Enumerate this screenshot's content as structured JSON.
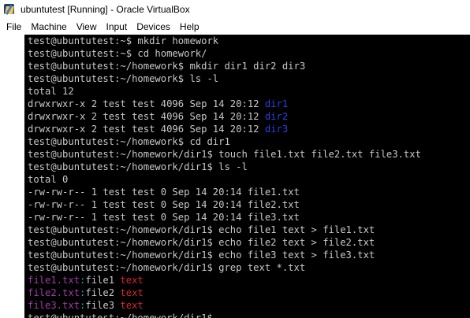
{
  "window": {
    "title": "ubuntutest [Running] - Oracle VirtualBox",
    "icon": "virtualbox-icon"
  },
  "menu": {
    "items": [
      "File",
      "Machine",
      "View",
      "Input",
      "Devices",
      "Help"
    ]
  },
  "colors": {
    "terminal_bg": "#000000",
    "terminal_fg": "#c8c8c8",
    "directory": "#2a3ee6",
    "grep_filename": "#a03ba8",
    "grep_separator": "#2aa7b8",
    "grep_match": "#d9262b"
  },
  "terminal": {
    "lines": [
      [
        {
          "t": "test@ubuntutest:~$ mkdir homework",
          "c": "default"
        }
      ],
      [
        {
          "t": "test@ubuntutest:~$ cd homework/",
          "c": "default"
        }
      ],
      [
        {
          "t": "test@ubuntutest:~/homework$ mkdir dir1 dir2 dir3",
          "c": "default"
        }
      ],
      [
        {
          "t": "test@ubuntutest:~/homework$ ls -l",
          "c": "default"
        }
      ],
      [
        {
          "t": "total 12",
          "c": "default"
        }
      ],
      [
        {
          "t": "drwxrwxr-x 2 test test 4096 Sep 14 20:12 ",
          "c": "default"
        },
        {
          "t": "dir1",
          "c": "blue"
        }
      ],
      [
        {
          "t": "drwxrwxr-x 2 test test 4096 Sep 14 20:12 ",
          "c": "default"
        },
        {
          "t": "dir2",
          "c": "blue"
        }
      ],
      [
        {
          "t": "drwxrwxr-x 2 test test 4096 Sep 14 20:12 ",
          "c": "default"
        },
        {
          "t": "dir3",
          "c": "blue"
        }
      ],
      [
        {
          "t": "test@ubuntutest:~/homework$ cd dir1",
          "c": "default"
        }
      ],
      [
        {
          "t": "test@ubuntutest:~/homework/dir1$ touch file1.txt file2.txt file3.txt",
          "c": "default"
        }
      ],
      [
        {
          "t": "test@ubuntutest:~/homework/dir1$ ls -l",
          "c": "default"
        }
      ],
      [
        {
          "t": "total 0",
          "c": "default"
        }
      ],
      [
        {
          "t": "-rw-rw-r-- 1 test test 0 Sep 14 20:14 file1.txt",
          "c": "default"
        }
      ],
      [
        {
          "t": "-rw-rw-r-- 1 test test 0 Sep 14 20:14 file2.txt",
          "c": "default"
        }
      ],
      [
        {
          "t": "-rw-rw-r-- 1 test test 0 Sep 14 20:14 file3.txt",
          "c": "default"
        }
      ],
      [
        {
          "t": "test@ubuntutest:~/homework/dir1$ echo file1 text > file1.txt",
          "c": "default"
        }
      ],
      [
        {
          "t": "test@ubuntutest:~/homework/dir1$ echo file2 text > file2.txt",
          "c": "default"
        }
      ],
      [
        {
          "t": "test@ubuntutest:~/homework/dir1$ echo file3 text > file3.txt",
          "c": "default"
        }
      ],
      [
        {
          "t": "test@ubuntutest:~/homework/dir1$ grep text *.txt",
          "c": "default"
        }
      ],
      [
        {
          "t": "file1.txt",
          "c": "magenta"
        },
        {
          "t": ":",
          "c": "cyan"
        },
        {
          "t": "file1 ",
          "c": "default"
        },
        {
          "t": "text",
          "c": "red"
        }
      ],
      [
        {
          "t": "file2.txt",
          "c": "magenta"
        },
        {
          "t": ":",
          "c": "cyan"
        },
        {
          "t": "file2 ",
          "c": "default"
        },
        {
          "t": "text",
          "c": "red"
        }
      ],
      [
        {
          "t": "file3.txt",
          "c": "magenta"
        },
        {
          "t": ":",
          "c": "cyan"
        },
        {
          "t": "file3 ",
          "c": "default"
        },
        {
          "t": "text",
          "c": "red"
        }
      ],
      [
        {
          "t": "test@ubuntutest:~/homework/dir1$",
          "c": "default"
        }
      ]
    ]
  }
}
